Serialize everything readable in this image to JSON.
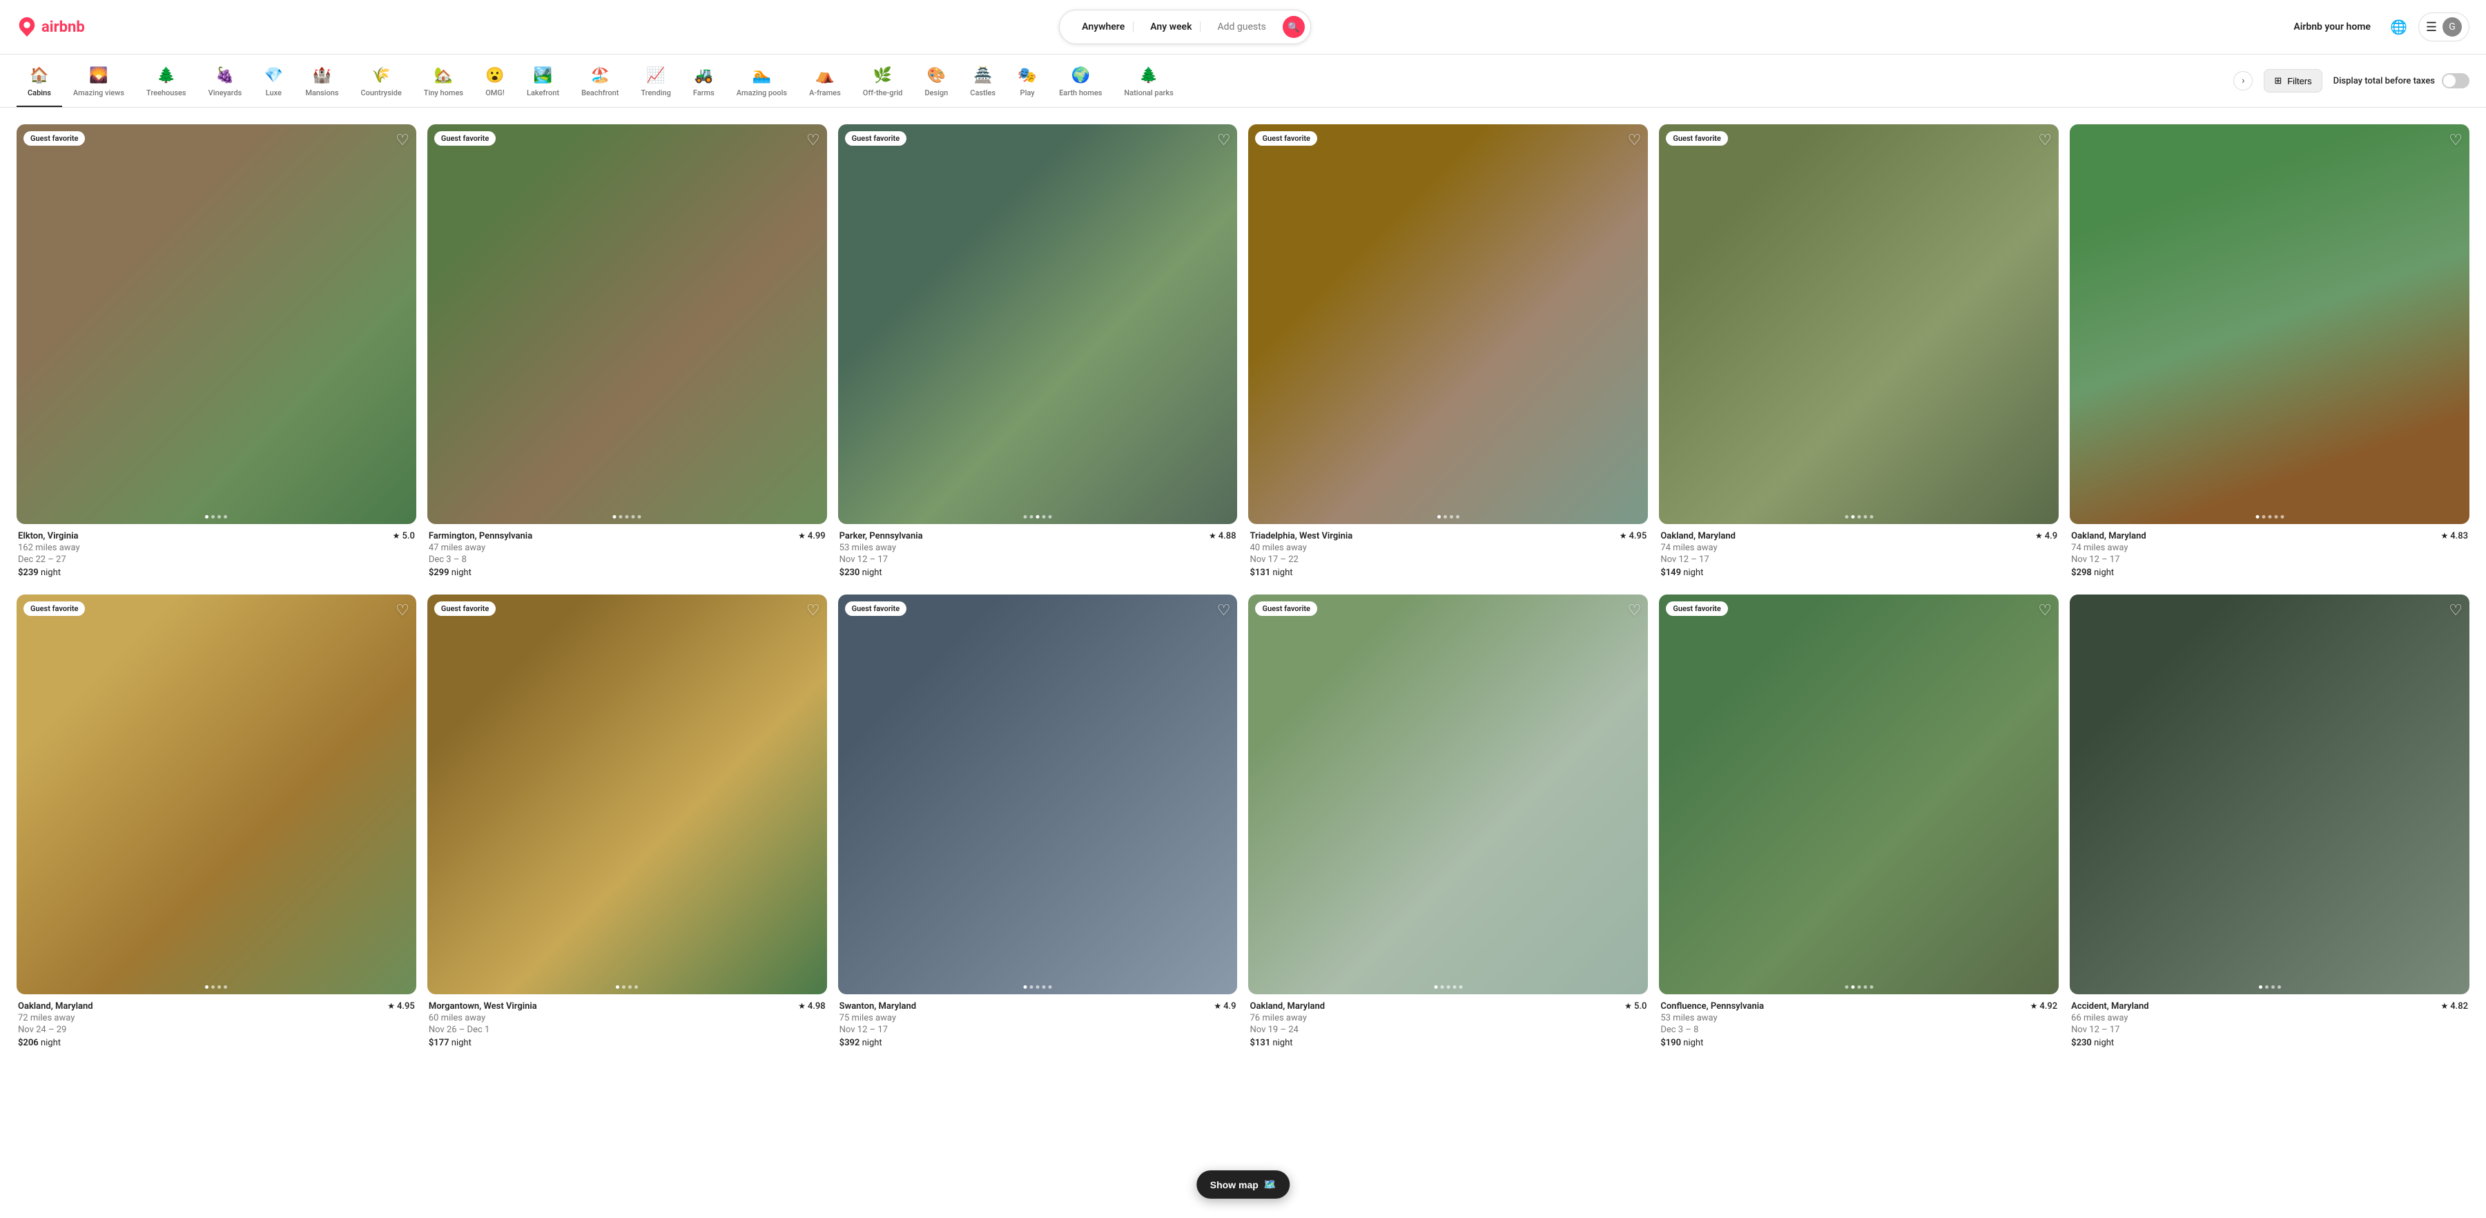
{
  "header": {
    "logo_text": "airbnb",
    "search": {
      "location": "Anywhere",
      "dates": "Any week",
      "guests": "Add guests"
    },
    "nav": {
      "airbnb_your_home": "Airbnb your home",
      "user_initial": "G"
    }
  },
  "categories": [
    {
      "id": "cabins",
      "icon": "🏠",
      "label": "Cabins",
      "active": true
    },
    {
      "id": "amazing-views",
      "icon": "🌄",
      "label": "Amazing views",
      "active": false
    },
    {
      "id": "treehouses",
      "icon": "🌲",
      "label": "Treehouses",
      "active": false
    },
    {
      "id": "vineyards",
      "icon": "🍇",
      "label": "Vineyards",
      "active": false
    },
    {
      "id": "luxe",
      "icon": "💎",
      "label": "Luxe",
      "active": false
    },
    {
      "id": "mansions",
      "icon": "🏰",
      "label": "Mansions",
      "active": false
    },
    {
      "id": "countryside",
      "icon": "🌾",
      "label": "Countryside",
      "active": false
    },
    {
      "id": "tiny-homes",
      "icon": "🏡",
      "label": "Tiny homes",
      "active": false
    },
    {
      "id": "omg",
      "icon": "😮",
      "label": "OMG!",
      "active": false
    },
    {
      "id": "lakefront",
      "icon": "🏞️",
      "label": "Lakefront",
      "active": false
    },
    {
      "id": "beachfront",
      "icon": "🏖️",
      "label": "Beachfront",
      "active": false
    },
    {
      "id": "trending",
      "icon": "📈",
      "label": "Trending",
      "active": false
    },
    {
      "id": "farms",
      "icon": "🚜",
      "label": "Farms",
      "active": false
    },
    {
      "id": "amazing-pools",
      "icon": "🏊",
      "label": "Amazing pools",
      "active": false
    },
    {
      "id": "a-frames",
      "icon": "⛺",
      "label": "A-frames",
      "active": false
    },
    {
      "id": "off-the-grid",
      "icon": "🌿",
      "label": "Off-the-grid",
      "active": false
    },
    {
      "id": "design",
      "icon": "🎨",
      "label": "Design",
      "active": false
    },
    {
      "id": "castles",
      "icon": "🏯",
      "label": "Castles",
      "active": false
    },
    {
      "id": "play",
      "icon": "🎭",
      "label": "Play",
      "active": false
    },
    {
      "id": "earth-homes",
      "icon": "🌍",
      "label": "Earth homes",
      "active": false
    },
    {
      "id": "national-parks",
      "icon": "🌲",
      "label": "National parks",
      "active": false
    }
  ],
  "filters": {
    "filters_label": "Filters",
    "display_total_label": "Display total before taxes",
    "filters_icon": "⊞"
  },
  "show_map": "Show map",
  "listings": [
    {
      "id": 1,
      "location": "Elkton, Virginia",
      "rating": "5.0",
      "distance": "162 miles away",
      "dates": "Dec 22 – 27",
      "price": "$239",
      "price_unit": "night",
      "guest_favorite": true,
      "img_class": "img-elkton",
      "dots": 4,
      "active_dot": 0
    },
    {
      "id": 2,
      "location": "Farmington, Pennsylvania",
      "rating": "4.99",
      "distance": "47 miles away",
      "dates": "Dec 3 – 8",
      "price": "$299",
      "price_unit": "night",
      "guest_favorite": true,
      "img_class": "img-farmington",
      "dots": 5,
      "active_dot": 0
    },
    {
      "id": 3,
      "location": "Parker, Pennsylvania",
      "rating": "4.88",
      "distance": "53 miles away",
      "dates": "Nov 12 – 17",
      "price": "$230",
      "price_unit": "night",
      "guest_favorite": true,
      "img_class": "img-parker",
      "dots": 5,
      "active_dot": 2
    },
    {
      "id": 4,
      "location": "Triadelphia, West Virginia",
      "rating": "4.95",
      "distance": "40 miles away",
      "dates": "Nov 17 – 22",
      "price": "$131",
      "price_unit": "night",
      "guest_favorite": true,
      "img_class": "img-triadelphia",
      "dots": 4,
      "active_dot": 0
    },
    {
      "id": 5,
      "location": "Oakland, Maryland",
      "rating": "4.9",
      "distance": "74 miles away",
      "dates": "Nov 12 – 17",
      "price": "$149",
      "price_unit": "night",
      "guest_favorite": true,
      "img_class": "img-oakland1",
      "dots": 5,
      "active_dot": 1
    },
    {
      "id": 6,
      "location": "Oakland, Maryland",
      "rating": "4.83",
      "distance": "74 miles away",
      "dates": "Nov 12 – 17",
      "price": "$298",
      "price_unit": "night",
      "guest_favorite": false,
      "img_class": "img-oakland2",
      "dots": 5,
      "active_dot": 0
    },
    {
      "id": 7,
      "location": "Oakland, Maryland",
      "rating": "4.95",
      "distance": "72 miles away",
      "dates": "Nov 24 – 29",
      "price": "$206",
      "price_unit": "night",
      "guest_favorite": true,
      "img_class": "img-oakland3",
      "dots": 4,
      "active_dot": 0
    },
    {
      "id": 8,
      "location": "Morgantown, West Virginia",
      "rating": "4.98",
      "distance": "60 miles away",
      "dates": "Nov 26 – Dec 1",
      "price": "$177",
      "price_unit": "night",
      "guest_favorite": true,
      "img_class": "img-morgantown",
      "dots": 4,
      "active_dot": 0
    },
    {
      "id": 9,
      "location": "Swanton, Maryland",
      "rating": "4.9",
      "distance": "75 miles away",
      "dates": "Nov 12 – 17",
      "price": "$392",
      "price_unit": "night",
      "guest_favorite": true,
      "img_class": "img-swanton",
      "dots": 5,
      "active_dot": 0
    },
    {
      "id": 10,
      "location": "Oakland, Maryland",
      "rating": "5.0",
      "distance": "76 miles away",
      "dates": "Nov 19 – 24",
      "price": "$131",
      "price_unit": "night",
      "guest_favorite": true,
      "img_class": "img-oakland4",
      "dots": 5,
      "active_dot": 0
    },
    {
      "id": 11,
      "location": "Confluence, Pennsylvania",
      "rating": "4.92",
      "distance": "53 miles away",
      "dates": "Dec 3 – 8",
      "price": "$190",
      "price_unit": "night",
      "guest_favorite": true,
      "img_class": "img-confluence",
      "dots": 5,
      "active_dot": 1
    },
    {
      "id": 12,
      "location": "Accident, Maryland",
      "rating": "4.82",
      "distance": "66 miles away",
      "dates": "Nov 12 – 17",
      "price": "$230",
      "price_unit": "night",
      "guest_favorite": false,
      "img_class": "img-accident",
      "dots": 4,
      "active_dot": 0
    }
  ]
}
